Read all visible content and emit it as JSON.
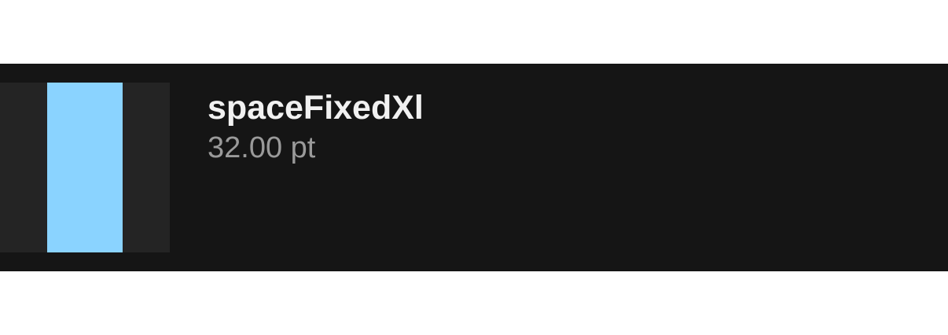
{
  "token": {
    "name": "spaceFixedXl",
    "value": "32.00 pt"
  },
  "colors": {
    "row_background": "#151515",
    "swatch_track": "#242424",
    "swatch_fill": "#8ad3ff",
    "name_text": "#f1f1f1",
    "value_text": "#9a9a9a"
  }
}
